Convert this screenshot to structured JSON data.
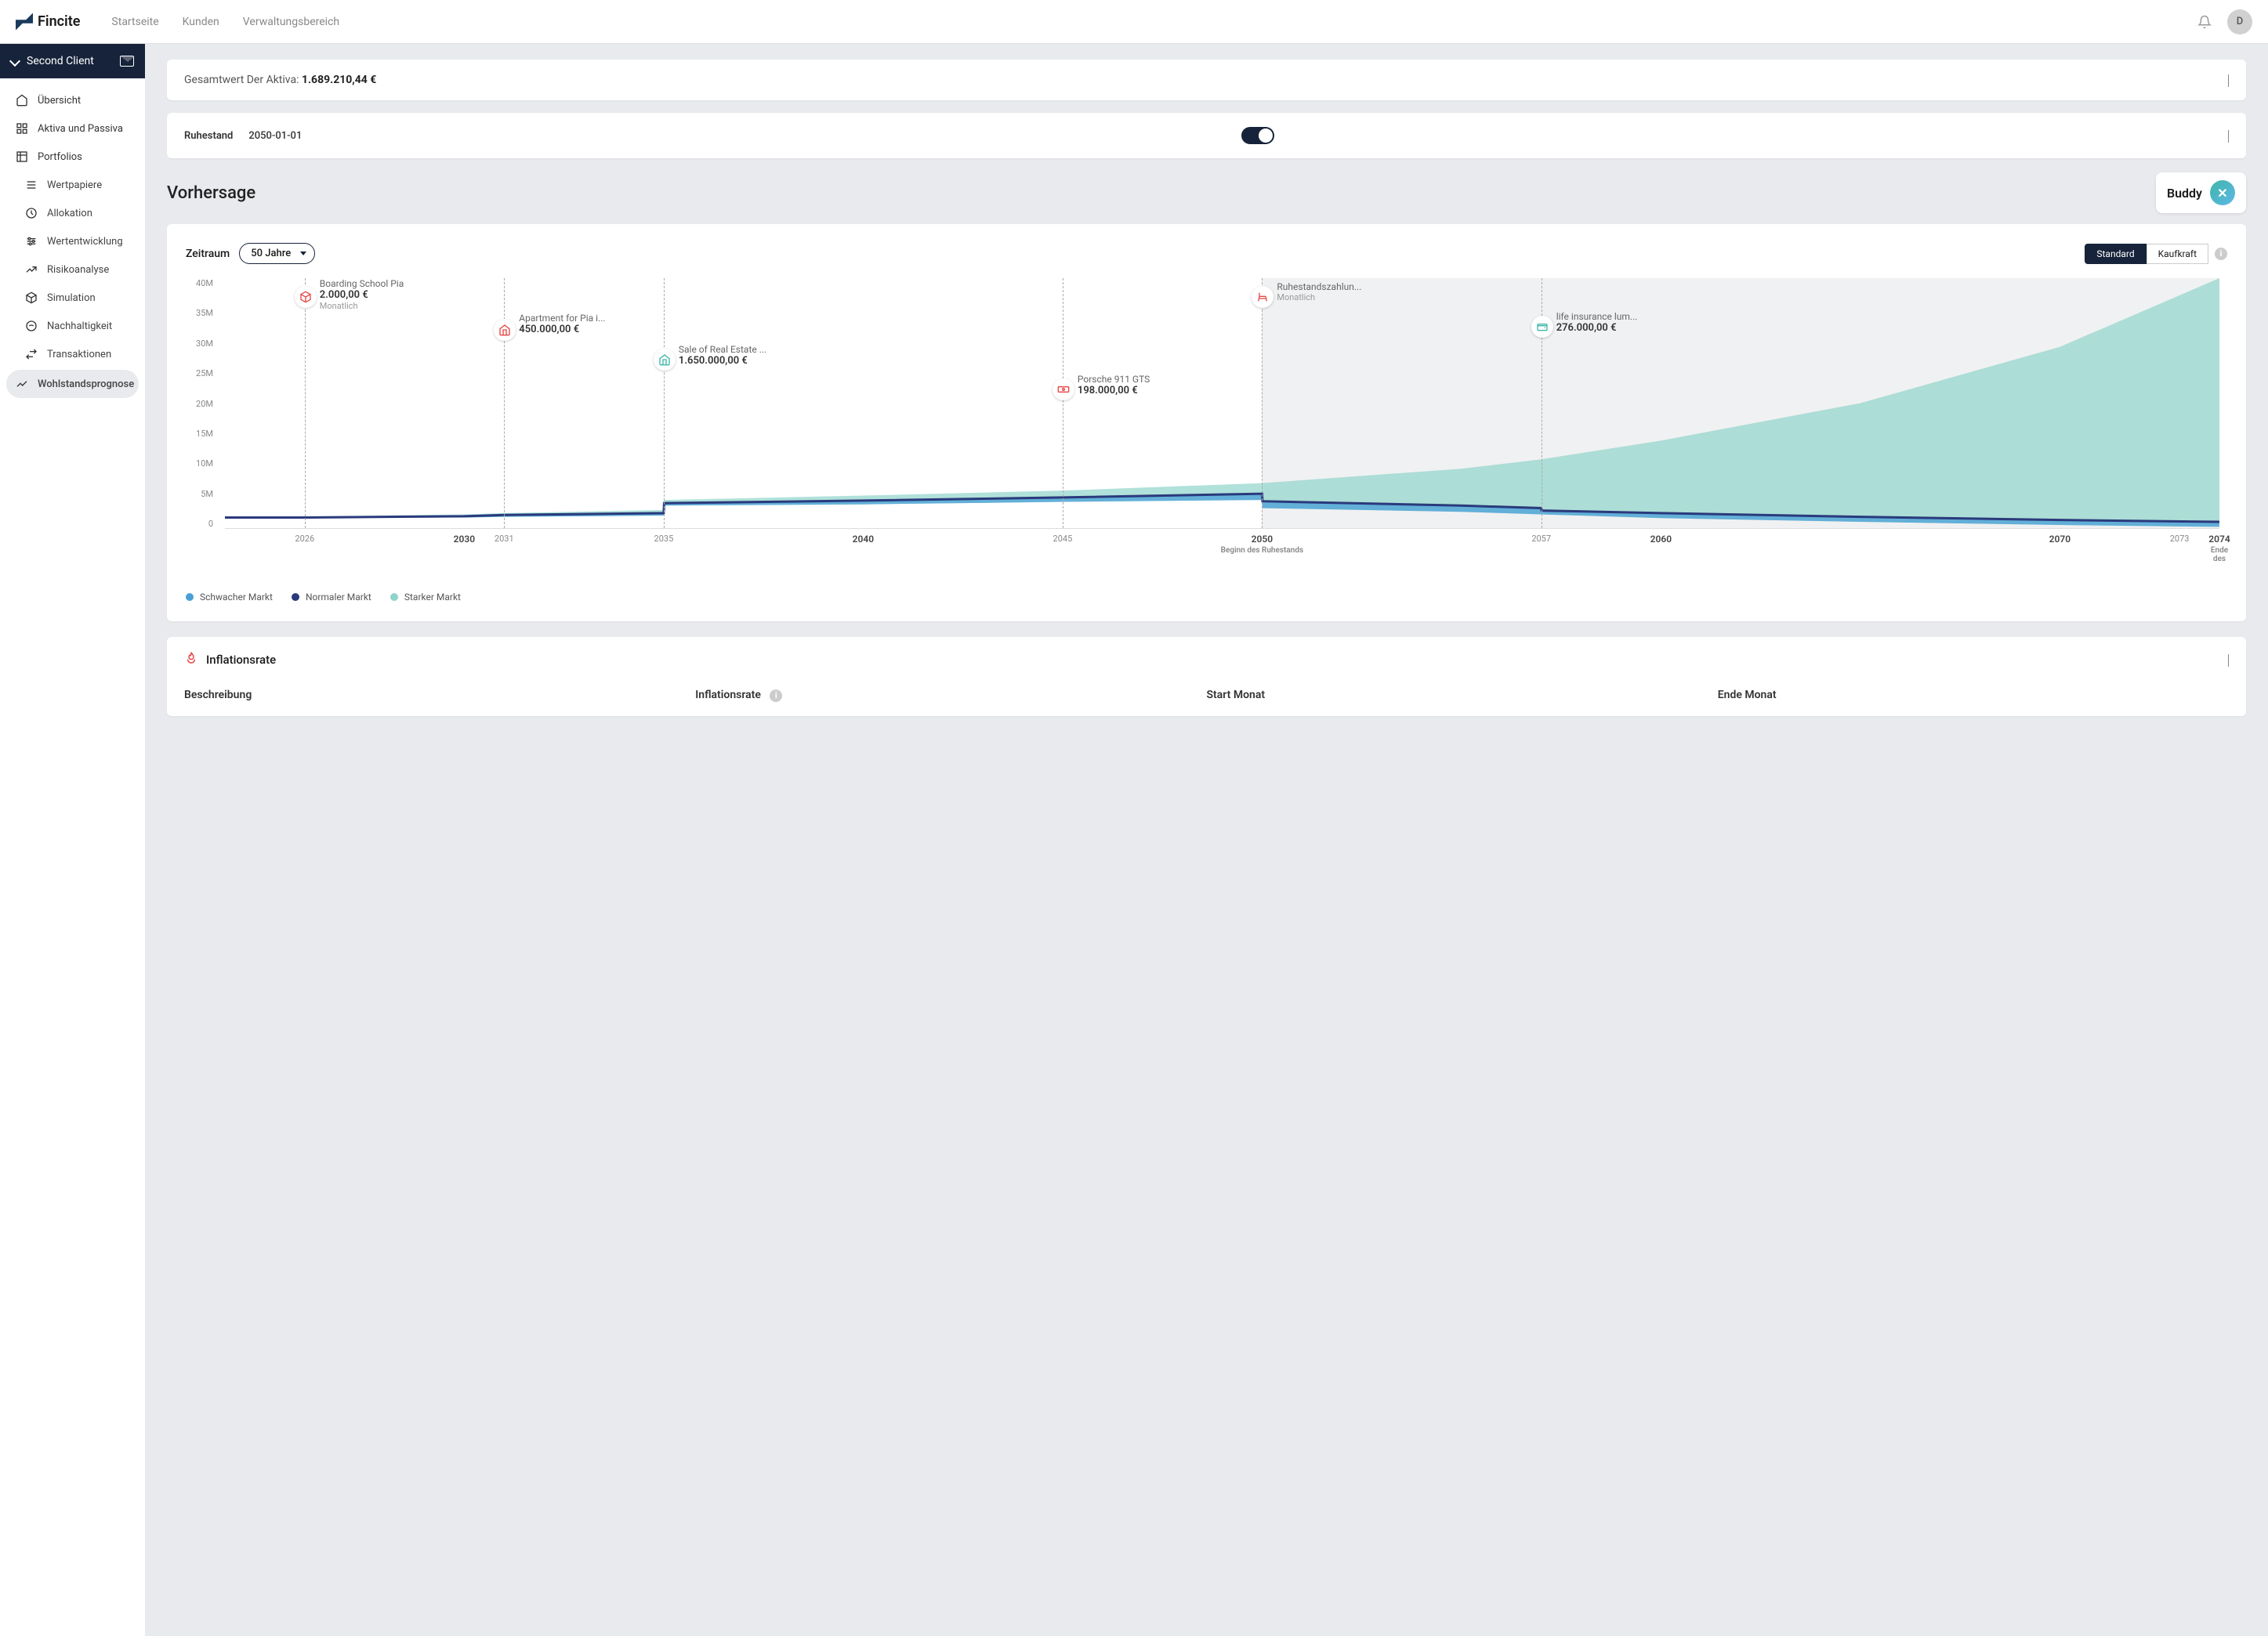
{
  "brand": "Fincite",
  "topnav": [
    "Startseite",
    "Kunden",
    "Verwaltungsbereich"
  ],
  "avatar_initial": "D",
  "client_header": "Second Client",
  "sidenav": {
    "main": [
      {
        "label": "Übersicht"
      },
      {
        "label": "Aktiva und Passiva"
      },
      {
        "label": "Portfolios"
      }
    ],
    "sub": [
      {
        "label": "Wertpapiere"
      },
      {
        "label": "Allokation"
      },
      {
        "label": "Wertentwicklung"
      },
      {
        "label": "Risikoanalyse"
      },
      {
        "label": "Simulation"
      },
      {
        "label": "Nachhaltigkeit"
      },
      {
        "label": "Transaktionen"
      },
      {
        "label": "Wohlstandsprognose",
        "active": true
      }
    ]
  },
  "gesamtwert": {
    "label": "Gesamtwert Der Aktiva:",
    "value": "1.689.210,44 €"
  },
  "ruhestand": {
    "label": "Ruhestand",
    "date": "2050-01-01"
  },
  "section_title": "Vorhersage",
  "buddy": "Buddy",
  "zeitraum_label": "Zeitraum",
  "period_selected": "50 Jahre",
  "view_toggle": {
    "standard": "Standard",
    "kaufkraft": "Kaufkraft"
  },
  "legend": {
    "weak": "Schwacher Markt",
    "normal": "Normaler Markt",
    "strong": "Starker Markt"
  },
  "colors": {
    "weak": "#4a9fd8",
    "normal": "#2a3a7c",
    "strong": "#8fd4ca",
    "event_red": "#e84545",
    "event_teal": "#3fb5a8"
  },
  "inflation": {
    "title": "Inflationsrate",
    "columns": [
      "Beschreibung",
      "Inflationsrate",
      "Start Monat",
      "Ende Monat"
    ]
  },
  "chart_data": {
    "type": "area",
    "ylabel": "",
    "ylim": [
      0,
      40
    ],
    "y_unit": "M",
    "y_ticks": [
      "40M",
      "35M",
      "30M",
      "25M",
      "20M",
      "15M",
      "10M",
      "5M",
      "0"
    ],
    "x_range": [
      2024,
      2074
    ],
    "x_ticks_minor": [
      2026,
      2031,
      2035,
      2045,
      2057,
      2073
    ],
    "x_ticks_major": [
      {
        "year": 2030,
        "sub": ""
      },
      {
        "year": 2040,
        "sub": ""
      },
      {
        "year": 2050,
        "sub": "Beginn des Ruhestands"
      },
      {
        "year": 2060,
        "sub": ""
      },
      {
        "year": 2070,
        "sub": ""
      },
      {
        "year": 2074,
        "sub": "Ende des"
      }
    ],
    "retirement_start": 2050,
    "series": [
      {
        "name": "Starker Markt",
        "color": "#8fd4ca",
        "points": [
          {
            "x": 2024,
            "y": 1.7
          },
          {
            "x": 2026,
            "y": 1.8
          },
          {
            "x": 2030,
            "y": 2.2
          },
          {
            "x": 2031,
            "y": 2.4
          },
          {
            "x": 2035,
            "y": 2.9
          },
          {
            "x": 2035.01,
            "y": 4.5
          },
          {
            "x": 2040,
            "y": 5.2
          },
          {
            "x": 2045,
            "y": 6.0
          },
          {
            "x": 2050,
            "y": 7.2
          },
          {
            "x": 2055,
            "y": 9.5
          },
          {
            "x": 2057,
            "y": 11.0
          },
          {
            "x": 2060,
            "y": 14.0
          },
          {
            "x": 2065,
            "y": 20.0
          },
          {
            "x": 2070,
            "y": 29.0
          },
          {
            "x": 2074,
            "y": 40.0
          }
        ]
      },
      {
        "name": "Schwacher Markt",
        "color": "#4a9fd8",
        "points": [
          {
            "x": 2024,
            "y": 1.6
          },
          {
            "x": 2030,
            "y": 1.7
          },
          {
            "x": 2031,
            "y": 1.8
          },
          {
            "x": 2035,
            "y": 2.0
          },
          {
            "x": 2035.01,
            "y": 3.6
          },
          {
            "x": 2040,
            "y": 3.8
          },
          {
            "x": 2045,
            "y": 4.2
          },
          {
            "x": 2050,
            "y": 4.5
          },
          {
            "x": 2050.01,
            "y": 3.2
          },
          {
            "x": 2055,
            "y": 2.6
          },
          {
            "x": 2057,
            "y": 2.2
          },
          {
            "x": 2060,
            "y": 1.6
          },
          {
            "x": 2065,
            "y": 1.0
          },
          {
            "x": 2070,
            "y": 0.5
          },
          {
            "x": 2074,
            "y": 0.2
          }
        ]
      },
      {
        "name": "Normaler Markt",
        "color": "#2a3a7c",
        "points": [
          {
            "x": 2024,
            "y": 1.7
          },
          {
            "x": 2026,
            "y": 1.7
          },
          {
            "x": 2030,
            "y": 1.9
          },
          {
            "x": 2031,
            "y": 2.1
          },
          {
            "x": 2035,
            "y": 2.4
          },
          {
            "x": 2035.01,
            "y": 4.0
          },
          {
            "x": 2040,
            "y": 4.4
          },
          {
            "x": 2045,
            "y": 4.9
          },
          {
            "x": 2050,
            "y": 5.5
          },
          {
            "x": 2050.01,
            "y": 4.3
          },
          {
            "x": 2055,
            "y": 3.6
          },
          {
            "x": 2057,
            "y": 3.2
          },
          {
            "x": 2057.01,
            "y": 2.8
          },
          {
            "x": 2060,
            "y": 2.4
          },
          {
            "x": 2065,
            "y": 1.8
          },
          {
            "x": 2070,
            "y": 1.3
          },
          {
            "x": 2074,
            "y": 1.0
          }
        ]
      }
    ],
    "events": [
      {
        "year": 2026,
        "title": "Boarding School Pia",
        "value": "2.000,00 €",
        "sub": "Monatlich",
        "icon": "box",
        "color": "#e84545",
        "marker_top": 10,
        "label_top": 0
      },
      {
        "year": 2031,
        "title": "Apartment for Pia i...",
        "value": "450.000,00 €",
        "sub": "",
        "icon": "home",
        "color": "#e84545",
        "marker_top": 52,
        "label_top": 44
      },
      {
        "year": 2035,
        "title": "Sale of Real Estate ...",
        "value": "1.650.000,00 €",
        "sub": "",
        "icon": "home",
        "color": "#3fb5a8",
        "marker_top": 90,
        "label_top": 84
      },
      {
        "year": 2045,
        "title": "Porsche 911 GTS",
        "value": "198.000,00 €",
        "sub": "",
        "icon": "cash",
        "color": "#e84545",
        "marker_top": 128,
        "label_top": 122
      },
      {
        "year": 2050,
        "title": "Ruhestandszahlun...",
        "value": "",
        "sub": "Monatlich",
        "icon": "chair",
        "color": "#e84545",
        "marker_top": 10,
        "label_top": 4
      },
      {
        "year": 2057,
        "title": "life insurance lum...",
        "value": "276.000,00 €",
        "sub": "",
        "icon": "wallet",
        "color": "#3fb5a8",
        "marker_top": 48,
        "label_top": 42
      }
    ]
  }
}
